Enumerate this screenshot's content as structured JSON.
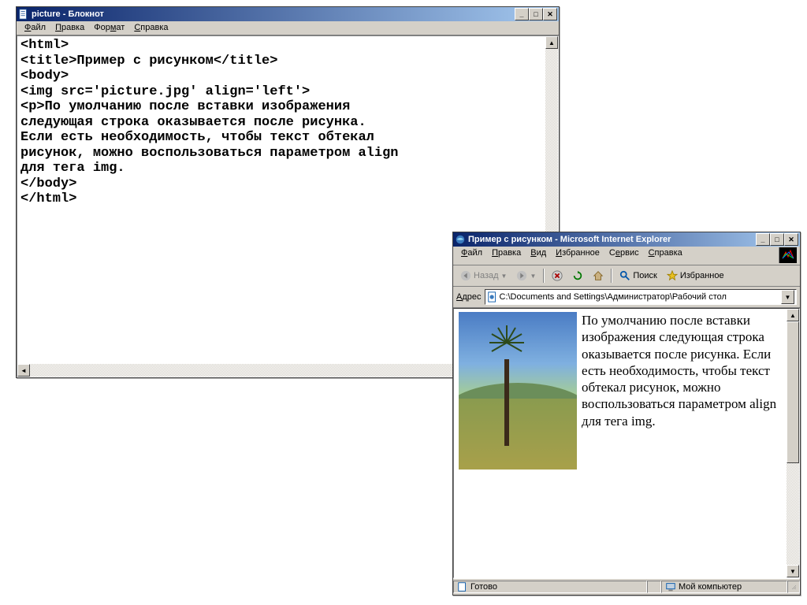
{
  "notepad": {
    "title": "picture - Блокнот",
    "menu": [
      "Файл",
      "Правка",
      "Формат",
      "Справка"
    ],
    "content": "<html>\n<title>Пример с рисунком</title>\n<body>\n<img src='picture.jpg' align='left'>\n<p>По умолчанию после вставки изображения\nследующая строка оказывается после рисунка.\nЕсли есть необходимость, чтобы текст обтекал\nрисунок, можно воспользоваться параметром align\nдля тега img.\n</body>\n</html>"
  },
  "ie": {
    "title": "Пример с рисунком - Microsoft Internet Explorer",
    "menu": [
      "Файл",
      "Правка",
      "Вид",
      "Избранное",
      "Сервис",
      "Справка"
    ],
    "toolbar": {
      "back": "Назад",
      "search": "Поиск",
      "favorites": "Избранное"
    },
    "address_label": "Адрес",
    "address_value": "C:\\Documents and Settings\\Администратор\\Рабочий стол",
    "body_text": "По умолчанию после вставки изображения следующая строка оказывается после рисунка. Если есть необходимость, чтобы текст обтекал рисунок, можно воспользоваться параметром align для тега img.",
    "status_left": "Готово",
    "status_right": "Мой компьютер"
  }
}
